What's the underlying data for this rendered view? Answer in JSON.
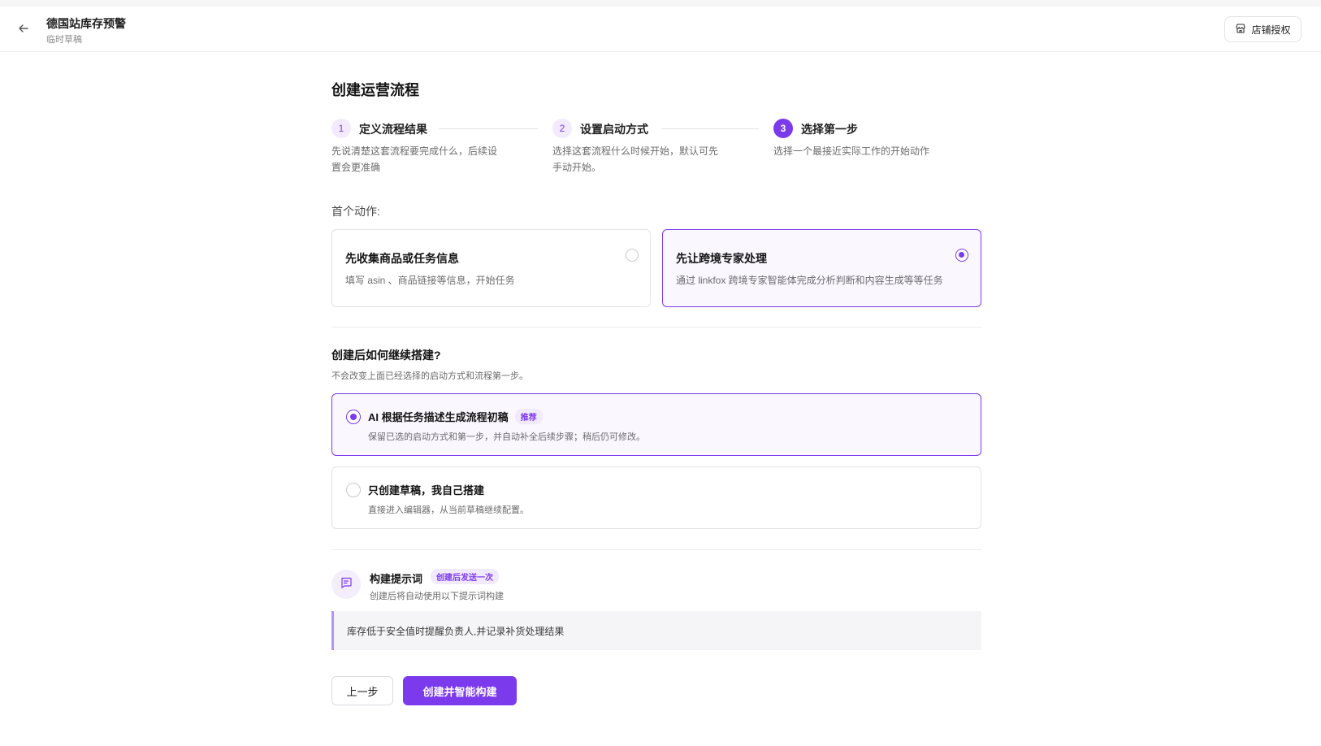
{
  "header": {
    "title": "德国站库存预警",
    "subtitle": "临时草稿",
    "store_auth_label": "店铺授权"
  },
  "page": {
    "title": "创建运营流程"
  },
  "steps": [
    {
      "number": "1",
      "label": "定义流程结果",
      "desc": "先说清楚这套流程要完成什么，后续设置会更准确",
      "state": "done"
    },
    {
      "number": "2",
      "label": "设置启动方式",
      "desc": "选择这套流程什么时候开始，默认可先手动开始。",
      "state": "done"
    },
    {
      "number": "3",
      "label": "选择第一步",
      "desc": "选择一个最接近实际工作的开始动作",
      "state": "active"
    }
  ],
  "first_action": {
    "label": "首个动作:",
    "options": [
      {
        "title": "先收集商品或任务信息",
        "desc": "填写 asin 、商品链接等信息，开始任务",
        "selected": false
      },
      {
        "title": "先让跨境专家处理",
        "desc": "通过 linkfox 跨境专家智能体完成分析判断和内容生成等等任务",
        "selected": true
      }
    ]
  },
  "continue_build": {
    "title": "创建后如何继续搭建?",
    "subtitle": "不会改变上面已经选择的启动方式和流程第一步。",
    "options": [
      {
        "title": "AI 根据任务描述生成流程初稿",
        "badge": "推荐",
        "desc": "保留已选的启动方式和第一步，并自动补全后续步骤；稍后仍可修改。",
        "selected": true
      },
      {
        "title": "只创建草稿，我自己搭建",
        "badge": "",
        "desc": "直接进入编辑器，从当前草稿继续配置。",
        "selected": false
      }
    ]
  },
  "prompt": {
    "title": "构建提示词",
    "badge": "创建后发送一次",
    "subtitle": "创建后将自动使用以下提示词构建",
    "text": "库存低于安全值时提醒负责人,并记录补货处理结果"
  },
  "actions": {
    "prev_label": "上一步",
    "create_label": "创建并智能构建"
  },
  "colors": {
    "accent": "#7c3aed",
    "accent_light": "#f1e9fd",
    "selected_bg": "#faf7ff"
  }
}
